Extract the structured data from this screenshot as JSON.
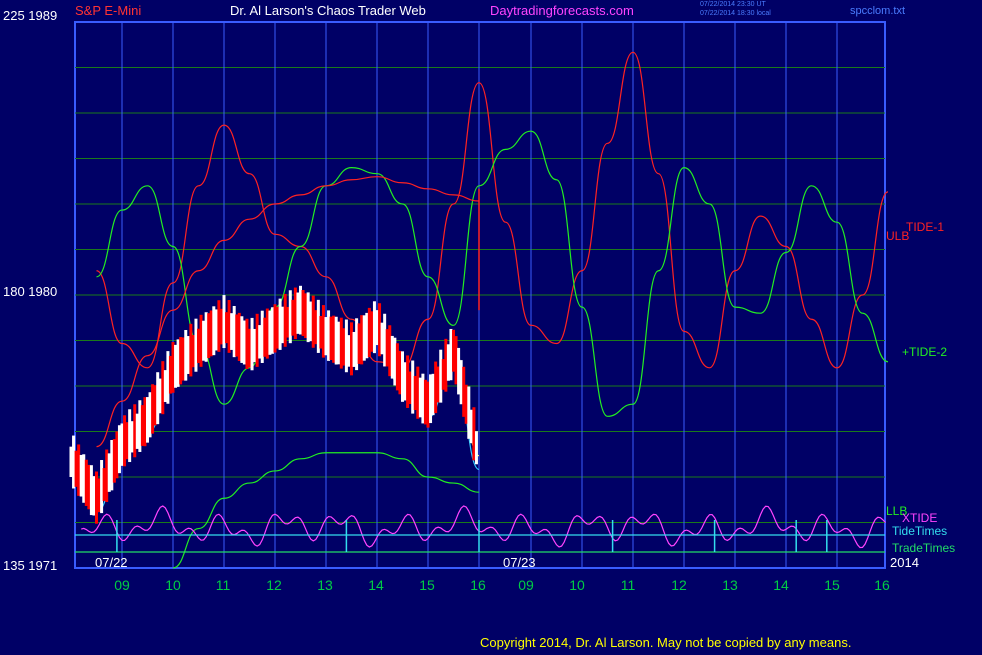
{
  "header": {
    "instrument": "S&P E-Mini",
    "title": "Dr. Al Larson's Chaos Trader Web",
    "site": "Daytradingforecasts.com",
    "timestamp_1": "07/22/2014 23:30 UT",
    "timestamp_2": "07/22/2014 18:30 local",
    "filename": "spcclom.txt"
  },
  "colors": {
    "background": "#000066",
    "grid": "#1a7a1a",
    "plot_border": "#3a5cff",
    "tide1": "#ff2222",
    "tide2": "#22ee22",
    "xtide": "#ff44ff",
    "tidetimes": "#33ddee",
    "tradetimes": "#22dd66",
    "bars_up": "#ffffff",
    "bars_down": "#ff0000",
    "ma_fast": "#ffff66",
    "ma_slow": "#33ccff",
    "band": "#ff2222"
  },
  "chart_data": {
    "type": "line",
    "y_axis_labels": [
      {
        "label": "225  1989",
        "pct": 225,
        "price": 1989
      },
      {
        "label": "180  1980",
        "pct": 180,
        "price": 1980
      },
      {
        "label": "135  1971",
        "pct": 135,
        "price": 1971
      }
    ],
    "ylim_price": [
      1971,
      1989
    ],
    "ylim_pct": [
      135,
      225
    ],
    "x_ticks": [
      "09",
      "10",
      "11",
      "12",
      "13",
      "14",
      "15",
      "16",
      "09",
      "10",
      "11",
      "12",
      "13",
      "14",
      "15",
      "16"
    ],
    "date_labels": [
      "07/22",
      "07/23",
      "2014"
    ],
    "right_labels": {
      "tide1": "TIDE-1",
      "ulb": "ULB",
      "tide2": "+TIDE-2",
      "llb": "LLB",
      "xtide": "XTIDE",
      "tidetimes": "TideTimes",
      "tradetimes": "TradeTimes"
    },
    "series": [
      {
        "name": "TIDE-1",
        "x_hours": [
          8.5,
          9.0,
          9.5,
          10.0,
          10.5,
          11.0,
          11.5,
          12.0,
          12.5,
          13.0,
          13.5,
          14.0,
          14.5,
          15.0,
          15.5,
          16.0,
          16.5,
          17.0,
          17.5,
          18.0,
          18.5,
          19.0,
          19.5,
          20.0,
          20.5,
          21.0,
          21.5,
          22.0,
          22.5,
          23.0,
          23.5,
          24.0
        ],
        "values_pct": [
          184,
          172,
          168,
          182,
          198,
          208,
          200,
          190,
          188,
          183,
          176,
          169,
          168,
          176,
          195,
          215,
          192,
          175,
          172,
          184,
          205,
          220,
          200,
          174,
          168,
          184,
          193,
          188,
          176,
          168,
          180,
          197
        ]
      },
      {
        "name": "+TIDE-2",
        "x_hours": [
          8.5,
          9.0,
          9.5,
          10.0,
          10.5,
          11.0,
          11.5,
          12.0,
          12.5,
          13.0,
          13.5,
          14.0,
          14.5,
          15.0,
          15.5,
          16.0,
          16.5,
          17.0,
          17.5,
          18.0,
          18.5,
          19.0,
          19.5,
          20.0,
          20.5,
          21.0,
          21.5,
          22.0,
          22.5,
          23.0,
          23.5,
          24.0
        ],
        "values_pct": [
          183,
          194,
          198,
          188,
          172,
          162,
          168,
          178,
          188,
          198,
          201,
          200,
          195,
          183,
          175,
          198,
          204,
          207,
          199,
          178,
          160,
          162,
          184,
          201,
          195,
          178,
          177,
          187,
          198,
          192,
          177,
          169
        ]
      },
      {
        "name": "Price",
        "x_hours": [
          8.0,
          8.5,
          9.0,
          9.5,
          10.0,
          10.5,
          11.0,
          11.5,
          12.0,
          12.5,
          13.0,
          13.5,
          14.0,
          14.5,
          15.0,
          15.5,
          16.0
        ],
        "values_price": [
          1974.5,
          1973.2,
          1975.0,
          1975.8,
          1977.5,
          1978.3,
          1979.0,
          1978.2,
          1978.8,
          1979.4,
          1978.6,
          1978.1,
          1978.9,
          1977.2,
          1976.3,
          1978.1,
          1974.6
        ]
      },
      {
        "name": "ULB",
        "x_hours": [
          8.5,
          9.0,
          9.5,
          10.0,
          10.5,
          11.0,
          11.5,
          12.0,
          12.5,
          13.0,
          13.5,
          14.0,
          14.5,
          15.0,
          15.5,
          16.0
        ],
        "values_price": [
          1975.0,
          1976.5,
          1978.0,
          1979.5,
          1980.8,
          1981.8,
          1982.5,
          1983.0,
          1983.3,
          1983.6,
          1983.8,
          1983.9,
          1983.7,
          1983.5,
          1983.3,
          1983.1
        ]
      },
      {
        "name": "LLB",
        "x_hours": [
          10.0,
          10.5,
          11.0,
          11.5,
          12.0,
          12.5,
          13.0,
          13.5,
          14.0,
          14.5,
          15.0,
          15.5,
          16.0
        ],
        "values_price": [
          1971.0,
          1972.3,
          1973.3,
          1973.8,
          1974.2,
          1974.6,
          1974.8,
          1974.8,
          1974.8,
          1974.6,
          1974.0,
          1973.8,
          1973.5
        ]
      }
    ]
  },
  "copyright": "Copyright 2014, Dr. Al Larson. May not be copied by any means."
}
